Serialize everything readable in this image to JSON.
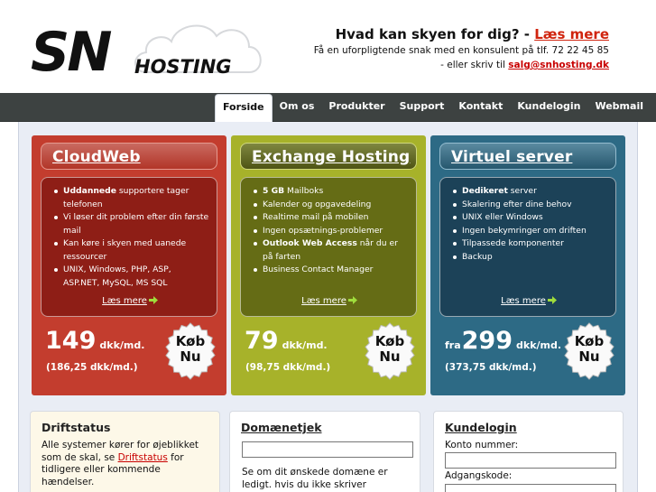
{
  "logo": {
    "sn": "SN",
    "hosting": "HOSTING"
  },
  "promo": {
    "headline": "Hvad kan skyen for dig? - ",
    "more": "Læs mere",
    "phone_line": "Få en uforpligtende snak med en konsulent på tlf. 72 22 45 85",
    "mail_prefix": "- eller skriv til ",
    "mail": "salg@snhosting.dk"
  },
  "nav": {
    "items": [
      {
        "label": "Forside",
        "active": true
      },
      {
        "label": "Om os"
      },
      {
        "label": "Produkter"
      },
      {
        "label": "Support"
      },
      {
        "label": "Kontakt"
      },
      {
        "label": "Kundelogin"
      },
      {
        "label": "Webmail"
      }
    ]
  },
  "plans": [
    {
      "title": "CloudWeb",
      "features": [
        {
          "bold": "Uddannede",
          "rest": " supportere tager telefonen"
        },
        {
          "bold": "",
          "rest": "Vi løser dit problem efter din første mail"
        },
        {
          "bold": "",
          "rest": "Kan køre i skyen med uanede ressourcer"
        },
        {
          "bold": "",
          "rest": "UNIX, Windows, PHP, ASP, ASP.NET, MySQL, MS SQL"
        }
      ],
      "more": "Læs mere",
      "price_prefix": "",
      "price": "149",
      "unit": "dkk/md.",
      "sub": "(186,25 dkk/md.)",
      "buy": [
        "Køb",
        "Nu"
      ]
    },
    {
      "title": "Exchange Hosting",
      "features": [
        {
          "bold": "5 GB",
          "rest": " Mailboks"
        },
        {
          "bold": "",
          "rest": "Kalender og opgavedeling"
        },
        {
          "bold": "",
          "rest": "Realtime mail på mobilen"
        },
        {
          "bold": "",
          "rest": "Ingen opsætnings-problemer"
        },
        {
          "bold": "Outlook Web Access",
          "rest": " når du er på farten"
        },
        {
          "bold": "",
          "rest": "Business Contact Manager"
        }
      ],
      "more": "Læs mere",
      "price_prefix": "",
      "price": "79",
      "unit": "dkk/md.",
      "sub": "(98,75 dkk/md.)",
      "buy": [
        "Køb",
        "Nu"
      ]
    },
    {
      "title": "Virtuel server",
      "features": [
        {
          "bold": "Dedikeret",
          "rest": " server"
        },
        {
          "bold": "",
          "rest": "Skalering efter dine behov"
        },
        {
          "bold": "",
          "rest": "UNIX eller Windows"
        },
        {
          "bold": "",
          "rest": "Ingen bekymringer om driften"
        },
        {
          "bold": "",
          "rest": "Tilpassede komponenter"
        },
        {
          "bold": "",
          "rest": "Backup"
        }
      ],
      "more": "Læs mere",
      "price_prefix": "fra",
      "price": "299",
      "unit": "dkk/md.",
      "sub": "(373,75 dkk/md.)",
      "buy": [
        "Køb",
        "Nu"
      ]
    }
  ],
  "status": {
    "title": "Driftstatus",
    "text_before": "Alle systemer kører for øjeblikket som de skal, se ",
    "link": "Driftstatus",
    "text_after": " for tidligere eller kommende hændelser."
  },
  "domain": {
    "title": "Domænetjek",
    "input_value": "",
    "text": "Se om dit ønskede domæne er ledigt. hvis du ikke skriver endelsen"
  },
  "login": {
    "title": "Kundelogin",
    "account_label": "Konto nummer:",
    "password_label": "Adgangskode:"
  },
  "colors": {
    "nav_bg": "#3d4241",
    "red": "#c33d2e",
    "green": "#a7b22a",
    "blue": "#2d6a85",
    "link_red": "#c80000"
  }
}
